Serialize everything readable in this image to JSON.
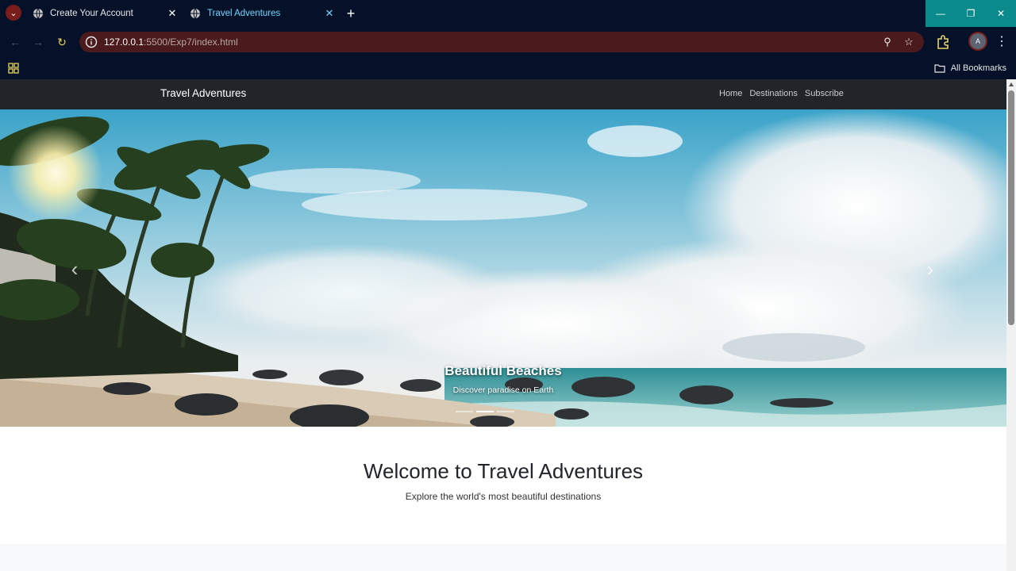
{
  "browser": {
    "tabs": [
      {
        "title": "Create Your Account",
        "active": false
      },
      {
        "title": "Travel Adventures",
        "active": true
      }
    ],
    "url_host": "127.0.0.1",
    "url_rest": ":5500/Exp7/index.html",
    "avatar_initial": "A",
    "bookmarks_label": "All Bookmarks",
    "colors": {
      "tab_active_text": "#6fd6ff",
      "omnibox_bg": "#4a1a1c",
      "window_controls": "#0a8a8a"
    }
  },
  "site": {
    "brand": "Travel Adventures",
    "nav": [
      "Home",
      "Destinations",
      "Subscribe"
    ],
    "carousel": {
      "slide_title": "Beautiful Beaches",
      "slide_subtitle": "Discover paradise on Earth",
      "indicator_count": 3,
      "active_indicator": 1
    },
    "welcome": {
      "title": "Welcome to Travel Adventures",
      "subtitle": "Explore the world's most beautiful destinations"
    },
    "colors": {
      "navbar_bg": "#212529",
      "page_bg": "#ffffff"
    }
  }
}
